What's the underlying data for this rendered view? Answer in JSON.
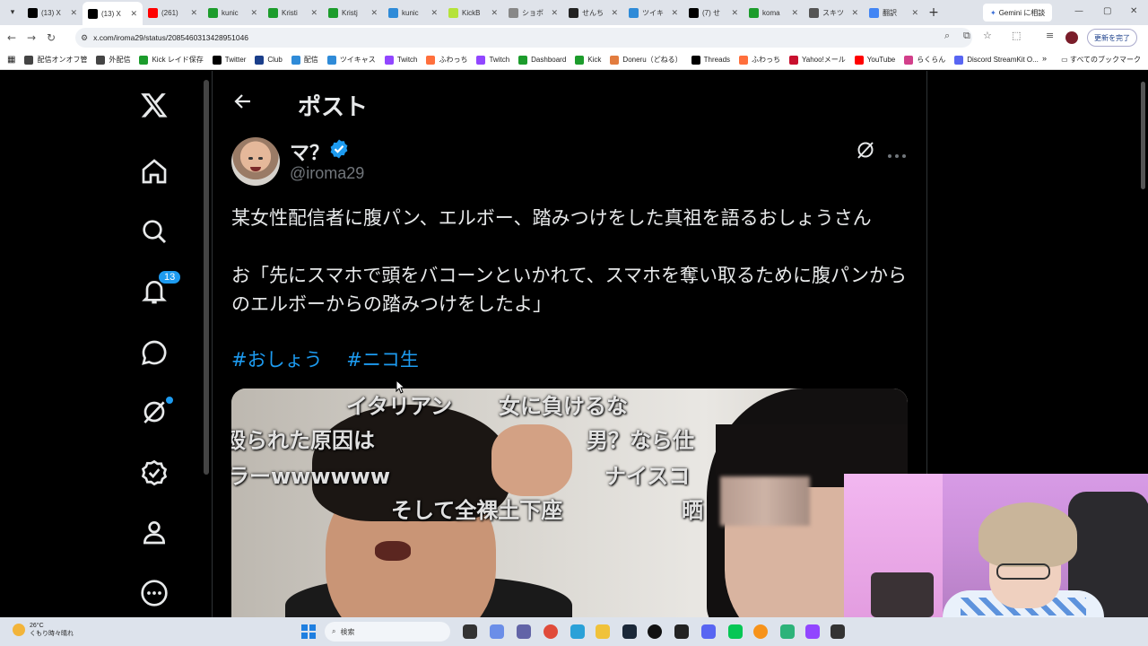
{
  "browser": {
    "tabs": [
      {
        "label": "(13) X",
        "icon": "x-logo-icon",
        "color": "#000000"
      },
      {
        "label": "(13) X",
        "icon": "x-logo-icon",
        "color": "#000000",
        "active": true
      },
      {
        "label": "(261)",
        "icon": "youtube-icon",
        "color": "#ff0000"
      },
      {
        "label": "kunic",
        "icon": "kick-icon",
        "color": "#1c9c2c"
      },
      {
        "label": "Kristi",
        "icon": "kick-icon",
        "color": "#1c9c2c"
      },
      {
        "label": "Kristj",
        "icon": "kick-icon",
        "color": "#1c9c2c"
      },
      {
        "label": "kunic",
        "icon": "twitcasting-icon",
        "color": "#2f8bd8"
      },
      {
        "label": "KickB",
        "icon": "kickbot-icon",
        "color": "#b5e33a"
      },
      {
        "label": "ショボ",
        "icon": "dots-icon",
        "color": "#888888"
      },
      {
        "label": "せんち",
        "icon": "site-icon",
        "color": "#222222"
      },
      {
        "label": "ツイキ",
        "icon": "twitcasting-icon",
        "color": "#2f8bd8"
      },
      {
        "label": "(7) せ",
        "icon": "x-logo-icon",
        "color": "#000000"
      },
      {
        "label": "koma",
        "icon": "kick-icon",
        "color": "#1c9c2c"
      },
      {
        "label": "スキツ",
        "icon": "site-icon",
        "color": "#555555"
      },
      {
        "label": "翻訳",
        "icon": "google-icon",
        "color": "#4285f4"
      }
    ],
    "gemini_label": "Gemini に相談",
    "url": "x.com/iroma29/status/2085460313428951046",
    "update_label": "更新を完了",
    "bookmarks": [
      {
        "label": "配信オンオフ管",
        "color": "#444444"
      },
      {
        "label": "外配信",
        "color": "#444444"
      },
      {
        "label": "Kick レイド保存",
        "color": "#1c9c2c"
      },
      {
        "label": "Twitter",
        "color": "#000000"
      },
      {
        "label": "Club",
        "color": "#1a3e8a"
      },
      {
        "label": "配信",
        "color": "#2f8bd8"
      },
      {
        "label": "ツイキャス",
        "color": "#2f8bd8"
      },
      {
        "label": "Twitch",
        "color": "#9146ff"
      },
      {
        "label": "ふわっち",
        "color": "#ff6f3c"
      },
      {
        "label": "Twitch",
        "color": "#9146ff"
      },
      {
        "label": "Dashboard",
        "color": "#1c9c2c"
      },
      {
        "label": "Kick",
        "color": "#1c9c2c"
      },
      {
        "label": "Doneru（どねる）",
        "color": "#e27c3f"
      },
      {
        "label": "Threads",
        "color": "#000000"
      },
      {
        "label": "ふわっち",
        "color": "#ff6f3c"
      },
      {
        "label": "Yahoo!メール",
        "color": "#c8102e"
      },
      {
        "label": "YouTube",
        "color": "#ff0000"
      },
      {
        "label": "らくらん",
        "color": "#d23f8a"
      },
      {
        "label": "Discord StreamKit O...",
        "color": "#5865f2"
      }
    ],
    "all_bookmarks_label": "すべてのブックマーク"
  },
  "sidebar": {
    "notifications_count": "13"
  },
  "post": {
    "header_title": "ポスト",
    "author_name": "マ？",
    "author_handle": "@iroma29",
    "text_line1": "某女性配信者に腹パン、エルボー、踏みつけをした真祖を語るおしょうさん",
    "text_line2": "お「先にスマホで頭をバコーンといかれて、スマホを奪い取るために腹パンからのエルボーからの踏みつけをしたよ」",
    "hashtags": [
      "#おしょう",
      "#ニコ生"
    ],
    "media_comments": [
      "イタリアン",
      "女に負けるな",
      "殴られた原因は",
      "男？なら仕",
      "ラーwwwwww",
      "ナイスコ",
      "そして全裸土下座",
      "晒"
    ]
  },
  "taskbar": {
    "temperature": "26°C",
    "weather": "くもり時々晴れ",
    "search_placeholder": "検索"
  },
  "colors": {
    "accent": "#1d9bf0",
    "text": "#e7e9ea",
    "muted": "#71767b",
    "background": "#000000"
  }
}
